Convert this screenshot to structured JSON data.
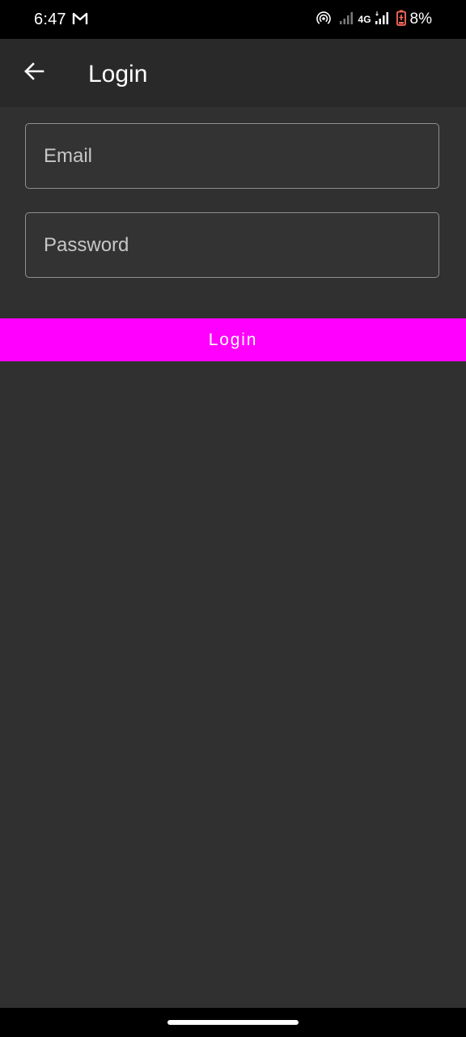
{
  "status_bar": {
    "time": "6:47",
    "mail_icon": "gmail-icon",
    "hotspot_icon": "hotspot-icon",
    "network_type": "4G",
    "battery_percent": "8%",
    "battery_color": "#ff6b5b"
  },
  "app_bar": {
    "back_icon": "arrow-back-icon",
    "title": "Login"
  },
  "form": {
    "email": {
      "value": "",
      "placeholder": "Email"
    },
    "password": {
      "value": "",
      "placeholder": "Password"
    },
    "login_label": "Login"
  },
  "colors": {
    "background": "#303030",
    "app_bar": "#292929",
    "accent": "#ff00ff"
  }
}
